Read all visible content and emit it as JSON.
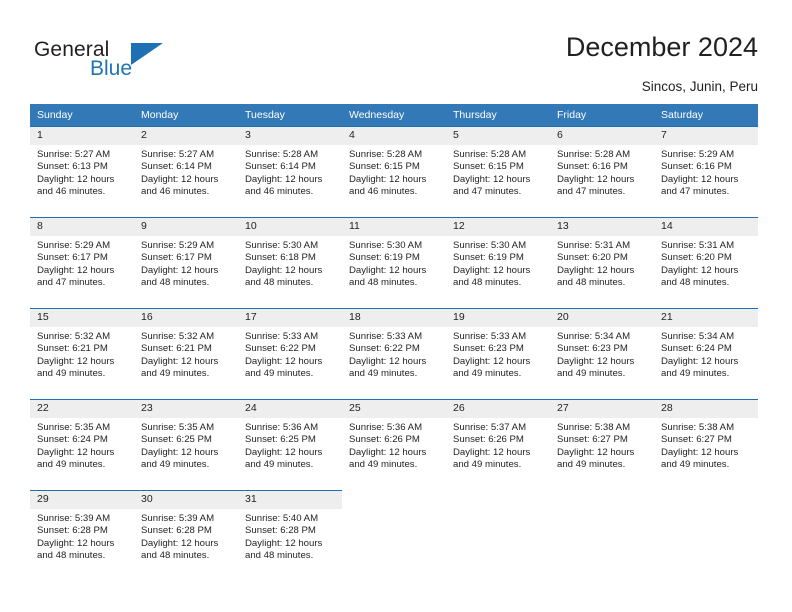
{
  "brand": {
    "name_part1": "General",
    "name_part2": "Blue",
    "triangle_color": "#1f6fb4",
    "blue_color": "#1f73b7"
  },
  "header": {
    "title": "December 2024",
    "location": "Sincos, Junin, Peru"
  },
  "theme": {
    "header_bg": "#3379b8",
    "row_rule": "#1f6fb4",
    "daynum_bg": "#eeeeee",
    "text": "#231f20"
  },
  "weekdays": [
    "Sunday",
    "Monday",
    "Tuesday",
    "Wednesday",
    "Thursday",
    "Friday",
    "Saturday"
  ],
  "weeks": [
    [
      {
        "day": "1",
        "sunrise": "Sunrise: 5:27 AM",
        "sunset": "Sunset: 6:13 PM",
        "daylight1": "Daylight: 12 hours",
        "daylight2": "and 46 minutes."
      },
      {
        "day": "2",
        "sunrise": "Sunrise: 5:27 AM",
        "sunset": "Sunset: 6:14 PM",
        "daylight1": "Daylight: 12 hours",
        "daylight2": "and 46 minutes."
      },
      {
        "day": "3",
        "sunrise": "Sunrise: 5:28 AM",
        "sunset": "Sunset: 6:14 PM",
        "daylight1": "Daylight: 12 hours",
        "daylight2": "and 46 minutes."
      },
      {
        "day": "4",
        "sunrise": "Sunrise: 5:28 AM",
        "sunset": "Sunset: 6:15 PM",
        "daylight1": "Daylight: 12 hours",
        "daylight2": "and 46 minutes."
      },
      {
        "day": "5",
        "sunrise": "Sunrise: 5:28 AM",
        "sunset": "Sunset: 6:15 PM",
        "daylight1": "Daylight: 12 hours",
        "daylight2": "and 47 minutes."
      },
      {
        "day": "6",
        "sunrise": "Sunrise: 5:28 AM",
        "sunset": "Sunset: 6:16 PM",
        "daylight1": "Daylight: 12 hours",
        "daylight2": "and 47 minutes."
      },
      {
        "day": "7",
        "sunrise": "Sunrise: 5:29 AM",
        "sunset": "Sunset: 6:16 PM",
        "daylight1": "Daylight: 12 hours",
        "daylight2": "and 47 minutes."
      }
    ],
    [
      {
        "day": "8",
        "sunrise": "Sunrise: 5:29 AM",
        "sunset": "Sunset: 6:17 PM",
        "daylight1": "Daylight: 12 hours",
        "daylight2": "and 47 minutes."
      },
      {
        "day": "9",
        "sunrise": "Sunrise: 5:29 AM",
        "sunset": "Sunset: 6:17 PM",
        "daylight1": "Daylight: 12 hours",
        "daylight2": "and 48 minutes."
      },
      {
        "day": "10",
        "sunrise": "Sunrise: 5:30 AM",
        "sunset": "Sunset: 6:18 PM",
        "daylight1": "Daylight: 12 hours",
        "daylight2": "and 48 minutes."
      },
      {
        "day": "11",
        "sunrise": "Sunrise: 5:30 AM",
        "sunset": "Sunset: 6:19 PM",
        "daylight1": "Daylight: 12 hours",
        "daylight2": "and 48 minutes."
      },
      {
        "day": "12",
        "sunrise": "Sunrise: 5:30 AM",
        "sunset": "Sunset: 6:19 PM",
        "daylight1": "Daylight: 12 hours",
        "daylight2": "and 48 minutes."
      },
      {
        "day": "13",
        "sunrise": "Sunrise: 5:31 AM",
        "sunset": "Sunset: 6:20 PM",
        "daylight1": "Daylight: 12 hours",
        "daylight2": "and 48 minutes."
      },
      {
        "day": "14",
        "sunrise": "Sunrise: 5:31 AM",
        "sunset": "Sunset: 6:20 PM",
        "daylight1": "Daylight: 12 hours",
        "daylight2": "and 48 minutes."
      }
    ],
    [
      {
        "day": "15",
        "sunrise": "Sunrise: 5:32 AM",
        "sunset": "Sunset: 6:21 PM",
        "daylight1": "Daylight: 12 hours",
        "daylight2": "and 49 minutes."
      },
      {
        "day": "16",
        "sunrise": "Sunrise: 5:32 AM",
        "sunset": "Sunset: 6:21 PM",
        "daylight1": "Daylight: 12 hours",
        "daylight2": "and 49 minutes."
      },
      {
        "day": "17",
        "sunrise": "Sunrise: 5:33 AM",
        "sunset": "Sunset: 6:22 PM",
        "daylight1": "Daylight: 12 hours",
        "daylight2": "and 49 minutes."
      },
      {
        "day": "18",
        "sunrise": "Sunrise: 5:33 AM",
        "sunset": "Sunset: 6:22 PM",
        "daylight1": "Daylight: 12 hours",
        "daylight2": "and 49 minutes."
      },
      {
        "day": "19",
        "sunrise": "Sunrise: 5:33 AM",
        "sunset": "Sunset: 6:23 PM",
        "daylight1": "Daylight: 12 hours",
        "daylight2": "and 49 minutes."
      },
      {
        "day": "20",
        "sunrise": "Sunrise: 5:34 AM",
        "sunset": "Sunset: 6:23 PM",
        "daylight1": "Daylight: 12 hours",
        "daylight2": "and 49 minutes."
      },
      {
        "day": "21",
        "sunrise": "Sunrise: 5:34 AM",
        "sunset": "Sunset: 6:24 PM",
        "daylight1": "Daylight: 12 hours",
        "daylight2": "and 49 minutes."
      }
    ],
    [
      {
        "day": "22",
        "sunrise": "Sunrise: 5:35 AM",
        "sunset": "Sunset: 6:24 PM",
        "daylight1": "Daylight: 12 hours",
        "daylight2": "and 49 minutes."
      },
      {
        "day": "23",
        "sunrise": "Sunrise: 5:35 AM",
        "sunset": "Sunset: 6:25 PM",
        "daylight1": "Daylight: 12 hours",
        "daylight2": "and 49 minutes."
      },
      {
        "day": "24",
        "sunrise": "Sunrise: 5:36 AM",
        "sunset": "Sunset: 6:25 PM",
        "daylight1": "Daylight: 12 hours",
        "daylight2": "and 49 minutes."
      },
      {
        "day": "25",
        "sunrise": "Sunrise: 5:36 AM",
        "sunset": "Sunset: 6:26 PM",
        "daylight1": "Daylight: 12 hours",
        "daylight2": "and 49 minutes."
      },
      {
        "day": "26",
        "sunrise": "Sunrise: 5:37 AM",
        "sunset": "Sunset: 6:26 PM",
        "daylight1": "Daylight: 12 hours",
        "daylight2": "and 49 minutes."
      },
      {
        "day": "27",
        "sunrise": "Sunrise: 5:38 AM",
        "sunset": "Sunset: 6:27 PM",
        "daylight1": "Daylight: 12 hours",
        "daylight2": "and 49 minutes."
      },
      {
        "day": "28",
        "sunrise": "Sunrise: 5:38 AM",
        "sunset": "Sunset: 6:27 PM",
        "daylight1": "Daylight: 12 hours",
        "daylight2": "and 49 minutes."
      }
    ],
    [
      {
        "day": "29",
        "sunrise": "Sunrise: 5:39 AM",
        "sunset": "Sunset: 6:28 PM",
        "daylight1": "Daylight: 12 hours",
        "daylight2": "and 48 minutes."
      },
      {
        "day": "30",
        "sunrise": "Sunrise: 5:39 AM",
        "sunset": "Sunset: 6:28 PM",
        "daylight1": "Daylight: 12 hours",
        "daylight2": "and 48 minutes."
      },
      {
        "day": "31",
        "sunrise": "Sunrise: 5:40 AM",
        "sunset": "Sunset: 6:28 PM",
        "daylight1": "Daylight: 12 hours",
        "daylight2": "and 48 minutes."
      },
      {
        "day": "",
        "sunrise": "",
        "sunset": "",
        "daylight1": "",
        "daylight2": ""
      },
      {
        "day": "",
        "sunrise": "",
        "sunset": "",
        "daylight1": "",
        "daylight2": ""
      },
      {
        "day": "",
        "sunrise": "",
        "sunset": "",
        "daylight1": "",
        "daylight2": ""
      },
      {
        "day": "",
        "sunrise": "",
        "sunset": "",
        "daylight1": "",
        "daylight2": ""
      }
    ]
  ]
}
